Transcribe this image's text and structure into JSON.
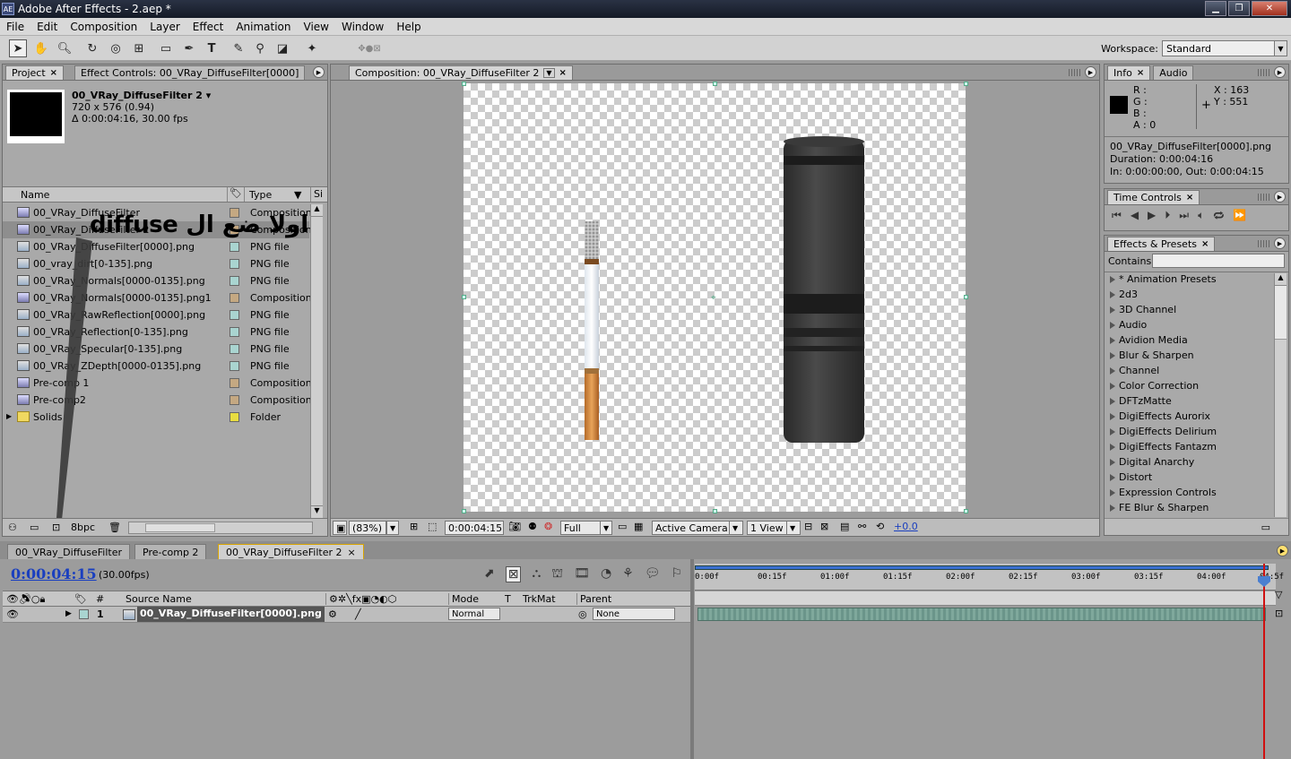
{
  "window": {
    "title": "Adobe After Effects - 2.aep *",
    "logo": "AE"
  },
  "menu": [
    "File",
    "Edit",
    "Composition",
    "Layer",
    "Effect",
    "Animation",
    "View",
    "Window",
    "Help"
  ],
  "toolbar": {
    "tools": [
      "selection-tool",
      "hand-tool",
      "zoom-tool",
      "rotation-tool",
      "orbit-camera-tool",
      "pan-behind-tool",
      "rectangle-tool",
      "pen-tool",
      "type-tool",
      "brush-tool",
      "clone-stamp-tool",
      "eraser-tool",
      "puppet-pin-tool"
    ],
    "workspace_label": "Workspace:",
    "workspace_value": "Standard"
  },
  "project_panel": {
    "tabs": [
      "Project",
      "Effect Controls: 00_VRay_DiffuseFilter[0000]"
    ],
    "selected_name": "00_VRay_DiffuseFilter 2",
    "selected_dims": "720 x 576 (0.94)",
    "selected_duration": "Δ 0:00:04:16, 30.00 fps",
    "columns": {
      "name": "Name",
      "type": "Type",
      "size": "Si"
    },
    "items": [
      {
        "name": "00_VRay_DiffuseFilter",
        "type": "Composition",
        "kind": "comp",
        "label": "#c4a882"
      },
      {
        "name": "00_VRay_DiffuseFilter 2",
        "type": "Composition",
        "kind": "comp",
        "label": "#c4a882"
      },
      {
        "name": "00_VRay_DiffuseFilter[0000].png",
        "type": "PNG file",
        "kind": "png",
        "label": "#a9d4d0"
      },
      {
        "name": "00_vray_dirt[0-135].png",
        "type": "PNG file",
        "kind": "png",
        "label": "#a9d4d0"
      },
      {
        "name": "00_VRay_Normals[0000-0135].png",
        "type": "PNG file",
        "kind": "png",
        "label": "#a9d4d0"
      },
      {
        "name": "00_VRay_Normals[0000-0135].png1",
        "type": "Composition",
        "kind": "comp",
        "label": "#c4a882"
      },
      {
        "name": "00_VRay_RawReflection[0000].png",
        "type": "PNG file",
        "kind": "png",
        "label": "#a9d4d0"
      },
      {
        "name": "00_VRay_Reflection[0-135].png",
        "type": "PNG file",
        "kind": "png",
        "label": "#a9d4d0"
      },
      {
        "name": "00_VRay_Specular[0-135].png",
        "type": "PNG file",
        "kind": "png",
        "label": "#a9d4d0"
      },
      {
        "name": "00_VRay_ZDepth[0000-0135].png",
        "type": "PNG file",
        "kind": "png",
        "label": "#a9d4d0"
      },
      {
        "name": "Pre-comp 1",
        "type": "Composition",
        "kind": "comp",
        "label": "#c4a882"
      },
      {
        "name": "Pre-comp2",
        "type": "Composition",
        "kind": "comp",
        "label": "#c4a882"
      },
      {
        "name": "Solids",
        "type": "Folder",
        "kind": "folder",
        "label": "#e8dc40"
      }
    ],
    "annotation": "اولا ضع ال diffuse",
    "bpc": "8bpc"
  },
  "composition_panel": {
    "tab": "Composition: 00_VRay_DiffuseFilter 2",
    "zoom": "(83%)",
    "timecode": "0:00:04:15",
    "resolution": "Full",
    "camera": "Active Camera",
    "views": "1 View",
    "exposure": "+0.0"
  },
  "info_panel": {
    "tabs": [
      "Info",
      "Audio"
    ],
    "r": "R :",
    "g": "G :",
    "b": "B :",
    "a": "A : 0",
    "x": "X : 163",
    "y": "Y : 551",
    "file": "00_VRay_DiffuseFilter[0000].png",
    "duration": "Duration: 0:00:04:16",
    "inout": "In: 0:00:00:00, Out: 0:00:04:15"
  },
  "time_controls": {
    "tab": "Time Controls"
  },
  "effects_panel": {
    "tab": "Effects & Presets",
    "contains_label": "Contains:",
    "items": [
      "* Animation Presets",
      "2d3",
      "3D Channel",
      "Audio",
      "Avidion Media",
      "Blur & Sharpen",
      "Channel",
      "Color Correction",
      "DFTzMatte",
      "DigiEffects Aurorix",
      "DigiEffects Delirium",
      "DigiEffects Fantazm",
      "Digital Anarchy",
      "Distort",
      "Expression Controls",
      "FE Blur & Sharpen"
    ]
  },
  "timeline": {
    "tabs": [
      "00_VRay_DiffuseFilter",
      "Pre-comp 2",
      "00_VRay_DiffuseFilter 2"
    ],
    "timecode": "0:00:04:15",
    "fps": "(30.00fps)",
    "columns": {
      "num": "#",
      "source": "Source Name",
      "mode": "Mode",
      "t": "T",
      "trkmat": "TrkMat",
      "parent": "Parent"
    },
    "ruler": [
      "0:00f",
      "00:15f",
      "01:00f",
      "01:15f",
      "02:00f",
      "02:15f",
      "03:00f",
      "03:15f",
      "04:00f",
      "04:5f"
    ],
    "layer": {
      "num": "1",
      "name": "00_VRay_DiffuseFilter[0000].png",
      "mode": "Normal",
      "parent": "None",
      "label": "#a9d4d0"
    }
  }
}
